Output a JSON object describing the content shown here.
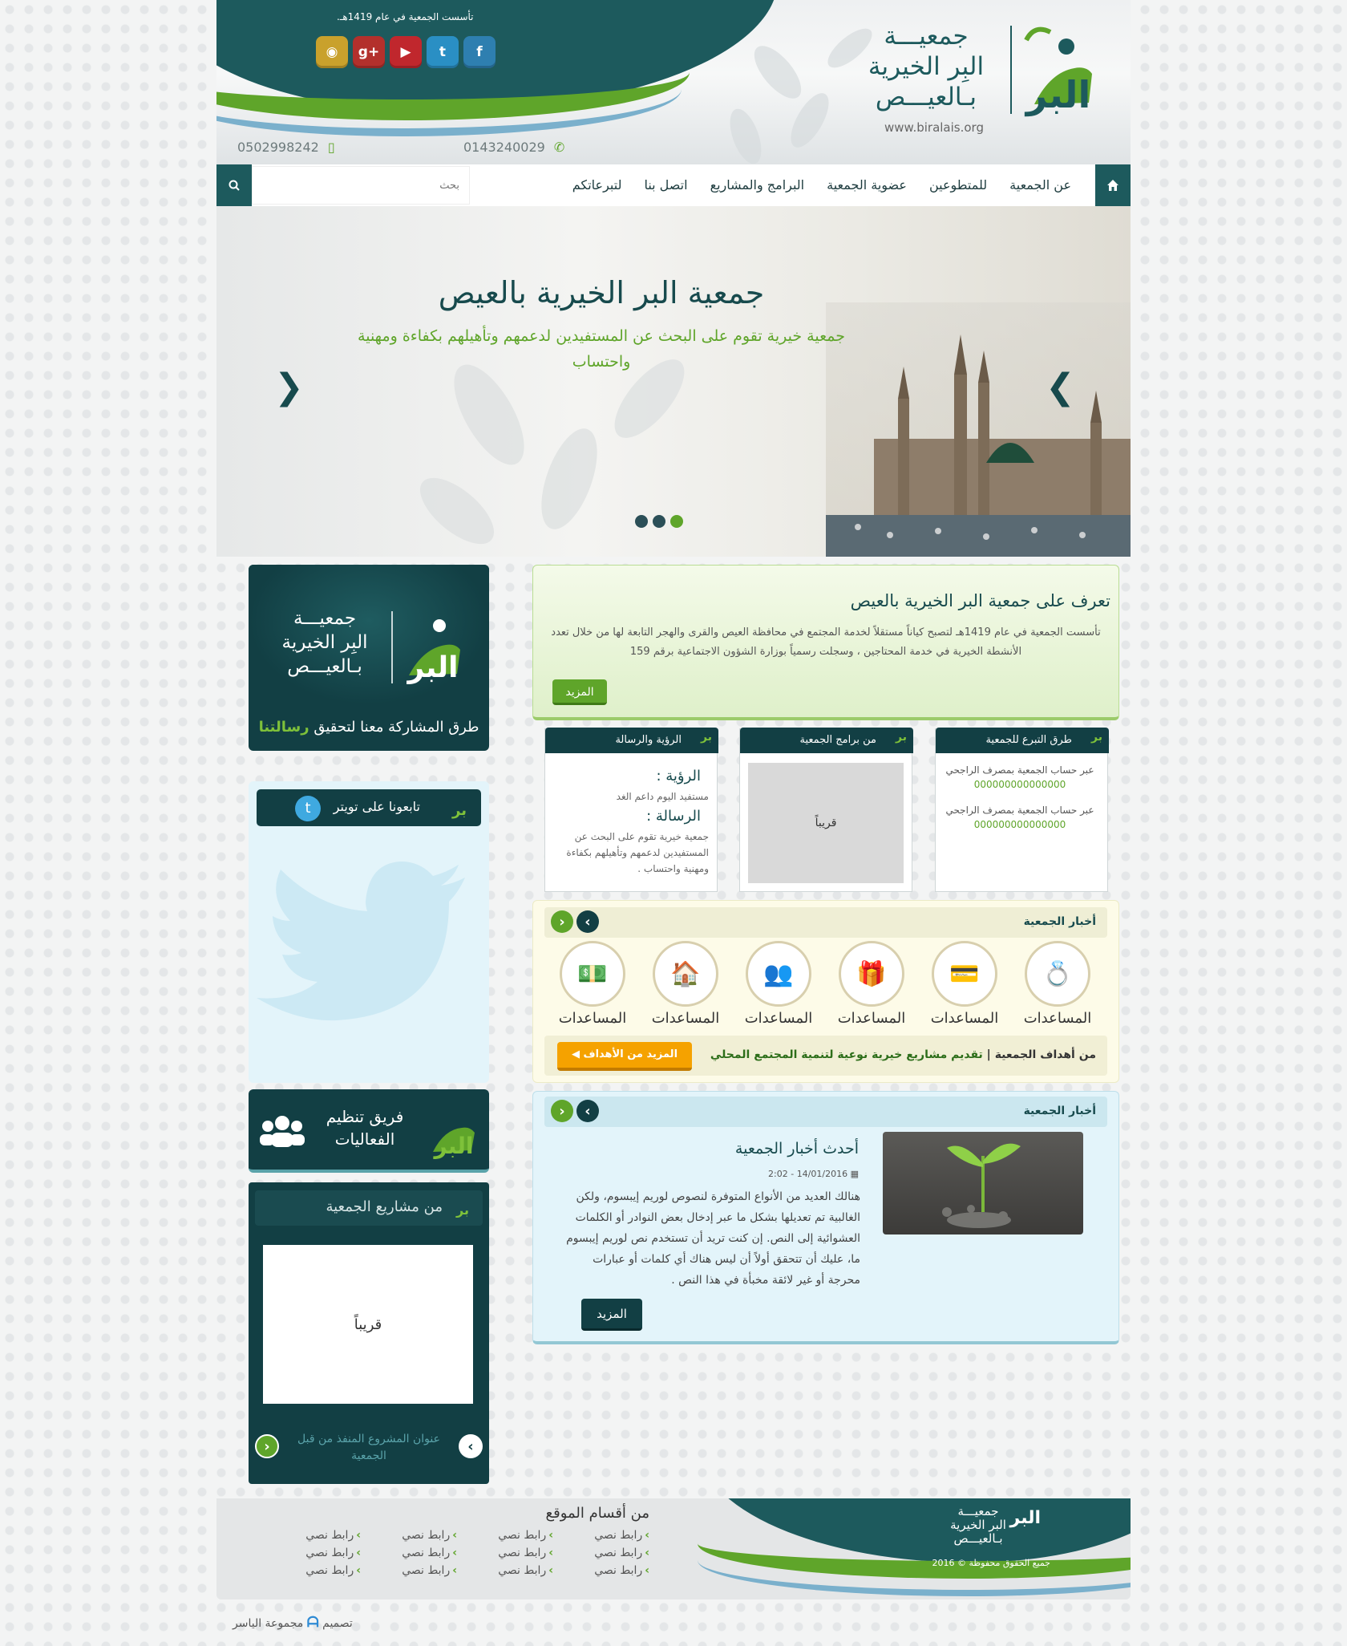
{
  "header": {
    "founded": "تأسست الجمعية في عام 1419هـ.",
    "logo_name_lines": [
      "جمعيـــة",
      "البِر الخيرية",
      "بـالعيـــص"
    ],
    "url": "www.biralais.org",
    "phone1": "0143240029",
    "phone2": "0502998242",
    "social": [
      {
        "name": "facebook-icon",
        "glyph": "f",
        "color": "#2e7fb0"
      },
      {
        "name": "twitter-icon",
        "glyph": "t",
        "color": "#2a8fc4"
      },
      {
        "name": "youtube-icon",
        "glyph": "▶",
        "color": "#c0272d"
      },
      {
        "name": "googleplus-icon",
        "glyph": "g+",
        "color": "#b3302c"
      },
      {
        "name": "rss-icon",
        "glyph": "◉",
        "color": "#c9a12c"
      }
    ]
  },
  "nav": {
    "items": [
      "عن الجمعية",
      "للمتطوعين",
      "عضوية الجمعية",
      "البرامج والمشاريع",
      "اتصل بنا",
      "لتبرعاتكم"
    ],
    "search_placeholder": "بحث"
  },
  "slider": {
    "title": "جمعية البر الخيرية بالعيص",
    "subtitle": "جمعية خيرية تقوم على البحث عن المستفيدين لدعمهم وتأهيلهم بكفاءة ومهنية واحتساب",
    "slides": 3,
    "active_slide": 1
  },
  "about": {
    "title": "تعرف على جمعية البر الخيرية بالعيص",
    "text": "تأسست الجمعية في عام 1419هـ لتصبح كياناً مستقلاً لخدمة المجتمع في محافظة العيص والقرى والهجر التابعة لها من خلال تعدد الأنشطة الخيرية في خدمة المحتاجين ، وسجلت رسمياً بوزارة الشؤون الاجتماعية برقم 159",
    "more": "المزيد"
  },
  "cards": {
    "donate": {
      "title": "طرق التبرع للجمعية",
      "accounts": [
        {
          "label": "عبر حساب الجمعية بمصرف الراجحي",
          "number": "000000000000000"
        },
        {
          "label": "عبر حساب الجمعية بمصرف الراجحي",
          "number": "000000000000000"
        }
      ]
    },
    "programs": {
      "title": "من برامج الجمعية",
      "placeholder": "قريباً"
    },
    "vision": {
      "title": "الرؤية والرسالة",
      "vision_h": "الرؤية :",
      "vision_p": "مستفيد اليوم داعم الغد",
      "mission_h": "الرسالة :",
      "mission_p": "جمعية خيرية تقوم على البحث عن المستفيدين لدعمهم وتأهيلهم بكفاءة ومهنية واحتساب ."
    }
  },
  "goals": {
    "title": "أخبار الجمعية",
    "icons": [
      {
        "name": "money-icon",
        "glyph": "💵",
        "label": "المساعدات"
      },
      {
        "name": "house-hands-icon",
        "glyph": "🏠",
        "label": "المساعدات"
      },
      {
        "name": "people-icon",
        "glyph": "👥",
        "label": "المساعدات"
      },
      {
        "name": "gift-icon",
        "glyph": "🎁",
        "label": "المساعدات"
      },
      {
        "name": "card-coins-icon",
        "glyph": "💳",
        "label": "المساعدات"
      },
      {
        "name": "rings-icon",
        "glyph": "💍",
        "label": "المساعدات"
      }
    ],
    "ticker_label": "من أهداف الجمعية",
    "ticker_text": "تقديم مشاريع خيرية نوعية لتنمية المجتمع المحلي",
    "more_goals": "المزيد من الأهداف ◀"
  },
  "news": {
    "title": "أخبار الجمعية",
    "headline": "أحدث أخبار الجمعية",
    "date": "14/01/2016 - 2:02",
    "body": "هنالك العديد من الأنواع المتوفرة لنصوص لوريم إيبسوم، ولكن الغالبية تم تعديلها بشكل ما عبر إدخال بعض النوادر أو الكلمات العشوائية إلى النص. إن كنت تريد أن تستخدم نص لوريم إيبسوم ما، عليك أن تتحقق أولاً أن ليس هناك أي كلمات أو عبارات محرجة أو غير لائقة مخبأة في هذا النص .",
    "more": "المزيد"
  },
  "sidebar": {
    "logo_lines": [
      "جمعيـــة",
      "البِر الخيرية",
      "بـالعيـــص"
    ],
    "caption_main": "طرق المشاركة معنا لتحقيق",
    "caption_accent": "رسالتنا",
    "twitter_title": "تابعونا على تويتر",
    "team_title": "فريق تنظيم الفعاليات",
    "projects_title": "من مشاريع الجمعية",
    "projects_placeholder": "قريباً",
    "project_caption": "عنوان المشروع المنفذ من قبل الجمعية"
  },
  "footer": {
    "logo_lines": [
      "جمعيـــة",
      "البر الخيرية",
      "بـالعيـــص"
    ],
    "copyright": "جميع الحقوق محفوظة © 2016",
    "sections_title": "من أقسام الموقع",
    "link_text": "رابط نصي",
    "credit_prefix": "تصميم",
    "credit_name": "مجموعة الياسر"
  },
  "colors": {
    "brand_dark": "#123f44",
    "brand_green": "#5fa52a",
    "accent_orange": "#f5a200"
  }
}
